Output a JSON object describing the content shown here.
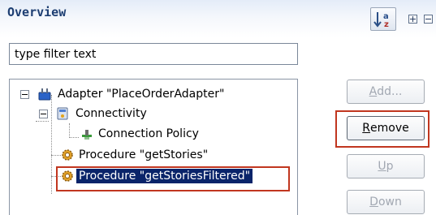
{
  "header": {
    "title": "Overview"
  },
  "toolbar": {
    "sort_icon": "sort-alpha-icon",
    "expand_icon": "expand-all-icon",
    "collapse_icon": "collapse-all-icon"
  },
  "filter": {
    "value": "type filter text"
  },
  "tree": {
    "adapter": "Adapter \"PlaceOrderAdapter\"",
    "connectivity": "Connectivity",
    "connection_policy": "Connection Policy",
    "procedure_1": "Procedure \"getStories\"",
    "procedure_2": "Procedure \"getStoriesFiltered\""
  },
  "buttons": {
    "add": {
      "mnemonic": "A",
      "rest": "dd..."
    },
    "remove": {
      "mnemonic": "R",
      "rest": "emove"
    },
    "up": {
      "mnemonic": "U",
      "rest": "p"
    },
    "down": {
      "mnemonic": "D",
      "rest": "own"
    }
  },
  "colors": {
    "highlight": "#c1361f",
    "selection": "#0a246a",
    "title": "#1d3e72"
  }
}
